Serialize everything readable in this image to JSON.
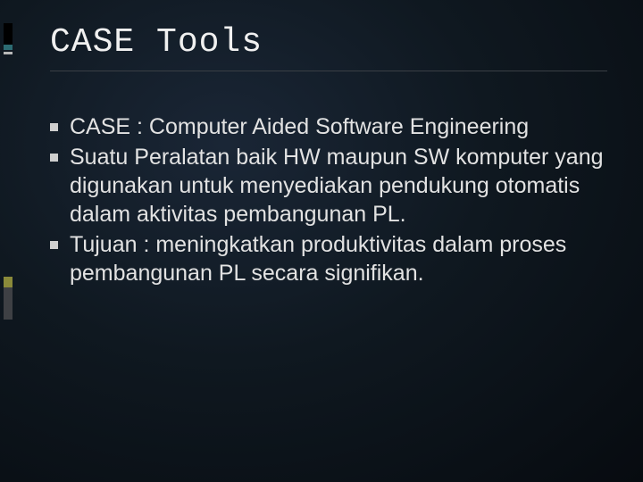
{
  "title": "CASE Tools",
  "bullets": [
    "CASE : Computer Aided Software Engineering",
    "Suatu Peralatan baik HW maupun SW komputer yang digunakan untuk menyediakan pendukung otomatis dalam aktivitas pembangunan PL.",
    "Tujuan : meningkatkan produktivitas dalam proses pembangunan PL secara signifikan."
  ]
}
